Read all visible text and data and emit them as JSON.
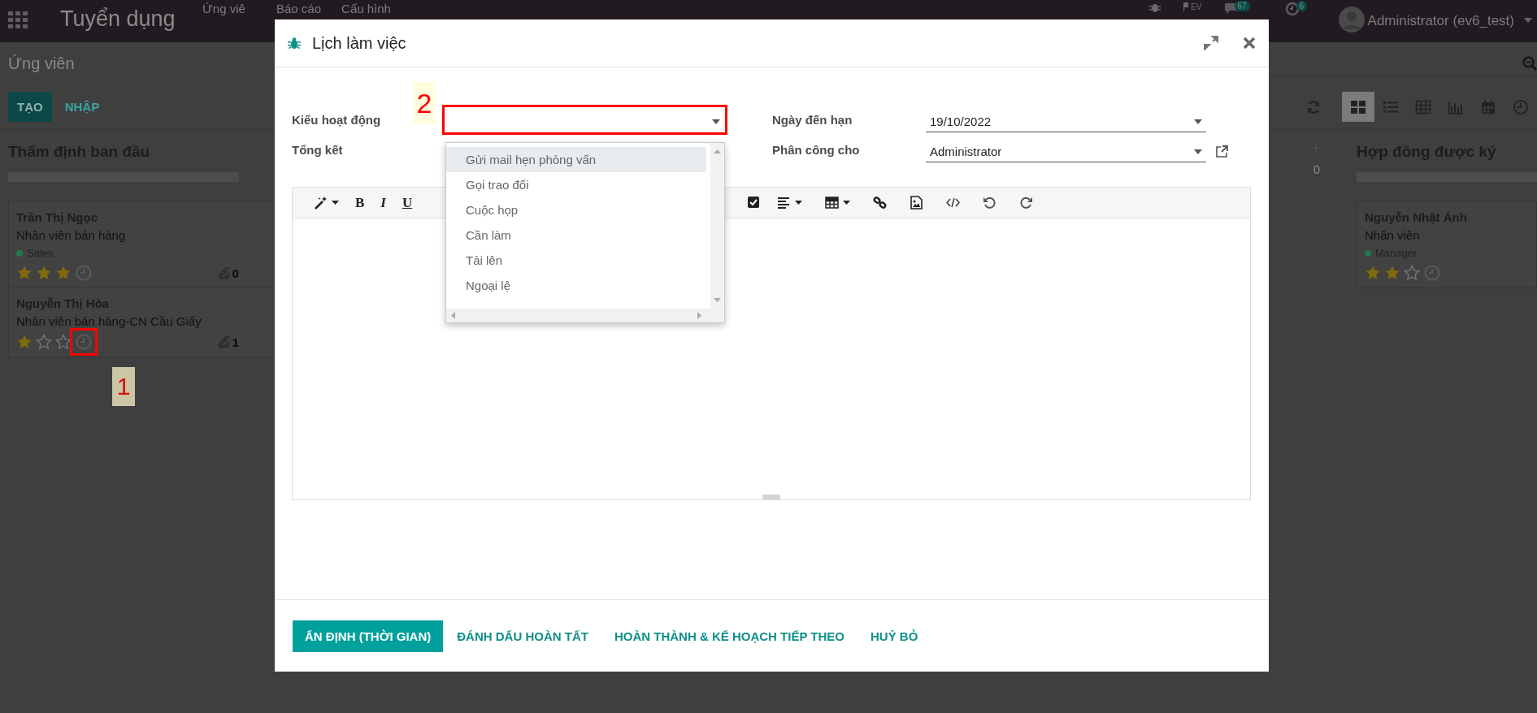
{
  "top_bar": {
    "app_title": "Tuyển dụng",
    "menu": [
      {
        "label": "Ứng viê"
      },
      {
        "label": "Báo cáo"
      },
      {
        "label": "Cấu hình"
      }
    ],
    "lang_label": "EV",
    "messages_badge": "67",
    "activities_badge": "6",
    "user": "Administrator (ev6_test)"
  },
  "control_panel": {
    "breadcrumb": "Ứng viên",
    "buttons": [
      {
        "label": "TẠO",
        "kind": "primary"
      },
      {
        "label": "NHẬP",
        "kind": "secondary"
      }
    ],
    "views": [
      {
        "kind": "kanban",
        "selected": true
      },
      {
        "kind": "list",
        "selected": false
      },
      {
        "kind": "pivot",
        "selected": false
      },
      {
        "kind": "graph",
        "selected": false
      },
      {
        "kind": "calendar",
        "selected": false
      },
      {
        "kind": "activity",
        "selected": false
      }
    ]
  },
  "kanban": {
    "columns": [
      {
        "kind": "full",
        "title": "Thẩm định ban đầu",
        "level": 0,
        "cards": [
          {
            "name": "Trần Thị Ngọc",
            "job": "Nhân viên bán hàng",
            "tag": {
              "label": "Sales",
              "color": "#1d7a4e"
            },
            "stars": 3,
            "attachments": "0"
          },
          {
            "name": "Nguyễn Thị Hòa",
            "job": "Nhân viên bán hàng-CN Cầu Giấy",
            "stars": 1,
            "attachments": "1"
          }
        ]
      },
      {
        "kind": "folded",
        "count": "0"
      },
      {
        "kind": "full",
        "title": "Hợp đồng được ký",
        "level": 0,
        "cards": [
          {
            "name": "Nguyễn Nhật Ánh",
            "job": "Nhân viên",
            "tag": {
              "label": "Manager",
              "color": "#1d7a4e"
            },
            "stars": 2
          }
        ]
      }
    ]
  },
  "dialog": {
    "title": "Lịch làm việc",
    "left_fields": [
      {
        "label": "Kiểu hoạt động",
        "kind": "select",
        "external_link": false
      },
      {
        "label": "Tổng kết",
        "kind": "text",
        "external_link": false
      }
    ],
    "right_fields": [
      {
        "label": "Ngày đến hạn",
        "kind": "select",
        "value": "19/10/2022",
        "external_link": false
      },
      {
        "label": "Phân công cho",
        "kind": "select",
        "value": "Administrator",
        "external_link": true
      }
    ],
    "dropdown": {
      "options": [
        {
          "label": "Gửi mail hẹn phỏng vấn",
          "selected": true
        },
        {
          "label": "Gọi trao đổi",
          "selected": false
        },
        {
          "label": "Cuộc họp",
          "selected": false
        },
        {
          "label": "Cần làm",
          "selected": false
        },
        {
          "label": "Tải lên",
          "selected": false
        },
        {
          "label": "Ngoại lệ",
          "selected": false
        }
      ]
    },
    "toolbar": [
      {
        "kind": "style"
      },
      {
        "kind": "bold",
        "label": "B"
      },
      {
        "kind": "italic",
        "label": "I"
      },
      {
        "kind": "underline",
        "label": "U"
      },
      {
        "kind": "checklist"
      },
      {
        "kind": "align"
      },
      {
        "kind": "table"
      },
      {
        "kind": "link"
      },
      {
        "kind": "image"
      },
      {
        "kind": "code"
      },
      {
        "kind": "undo"
      },
      {
        "kind": "redo"
      }
    ],
    "buttons": [
      {
        "label": "ẤN ĐỊNH (THỜI GIAN)",
        "kind": "primary"
      },
      {
        "label": "ĐÁNH DẤU HOÀN TẤT",
        "kind": "link"
      },
      {
        "label": "HOÀN THÀNH & KẾ HOẠCH TIẾP THEO",
        "kind": "link"
      },
      {
        "label": "HUỶ BỎ",
        "kind": "link"
      }
    ]
  },
  "annotations": [
    {
      "label": "1"
    },
    {
      "label": "2"
    }
  ]
}
